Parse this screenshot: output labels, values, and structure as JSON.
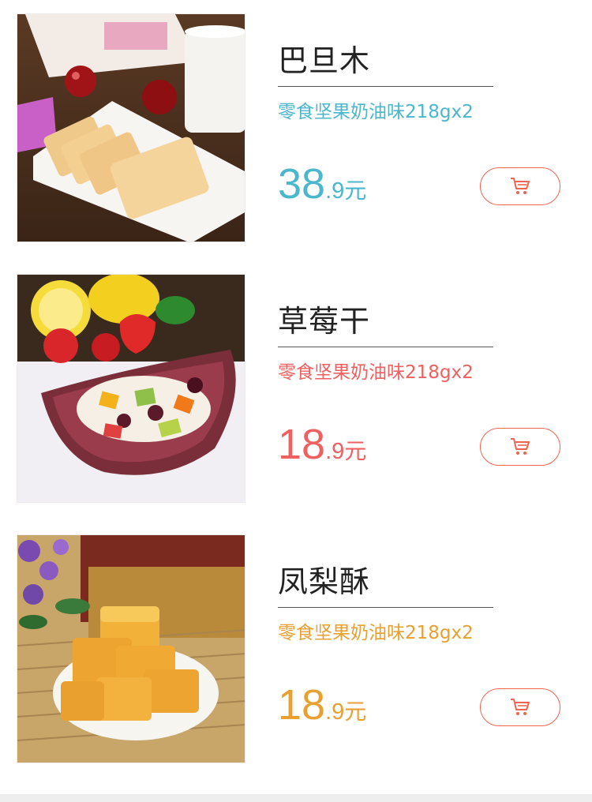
{
  "products": [
    {
      "name": "巴旦木",
      "spec": "零食坚果奶油味218gx2",
      "price_int": "38",
      "price_dec": ".9",
      "price_unit": "元",
      "accent_color": "#4bb6cc",
      "image_icon": "biscuit-image",
      "cart_icon": "cart-icon"
    },
    {
      "name": "草莓干",
      "spec": "零食坚果奶油味218gx2",
      "price_int": "18",
      "price_dec": ".9",
      "price_unit": "元",
      "accent_color": "#ef6060",
      "image_icon": "fruit-salad-image",
      "cart_icon": "cart-icon"
    },
    {
      "name": "凤梨酥",
      "spec": "零食坚果奶油味218gx2",
      "price_int": "18",
      "price_dec": ".9",
      "price_unit": "元",
      "accent_color": "#e8a030",
      "image_icon": "pineapple-cake-image",
      "cart_icon": "cart-icon"
    }
  ],
  "colors": {
    "cart_button_border": "#ef6450",
    "divider": "#555555",
    "name_text": "#222222"
  }
}
